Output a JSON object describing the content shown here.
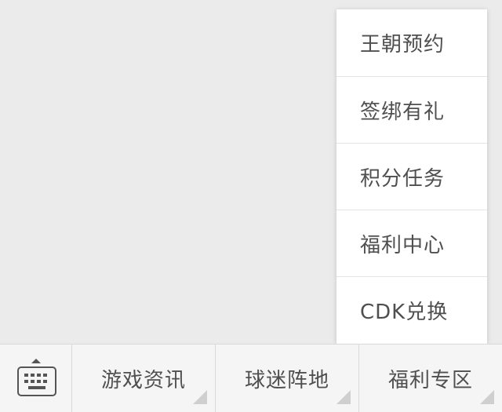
{
  "popup_menu": {
    "items": [
      {
        "label": "王朝预约"
      },
      {
        "label": "签绑有礼"
      },
      {
        "label": "积分任务"
      },
      {
        "label": "福利中心"
      },
      {
        "label": "CDK兑换"
      }
    ]
  },
  "bottom_bar": {
    "keyboard_icon": "keyboard-icon",
    "menus": [
      {
        "label": "游戏资讯"
      },
      {
        "label": "球迷阵地"
      },
      {
        "label": "福利专区"
      }
    ]
  },
  "colors": {
    "background": "#ebebeb",
    "bar_background": "#f5f5f5",
    "menu_background": "#ffffff",
    "text": "#4f4f4f"
  }
}
